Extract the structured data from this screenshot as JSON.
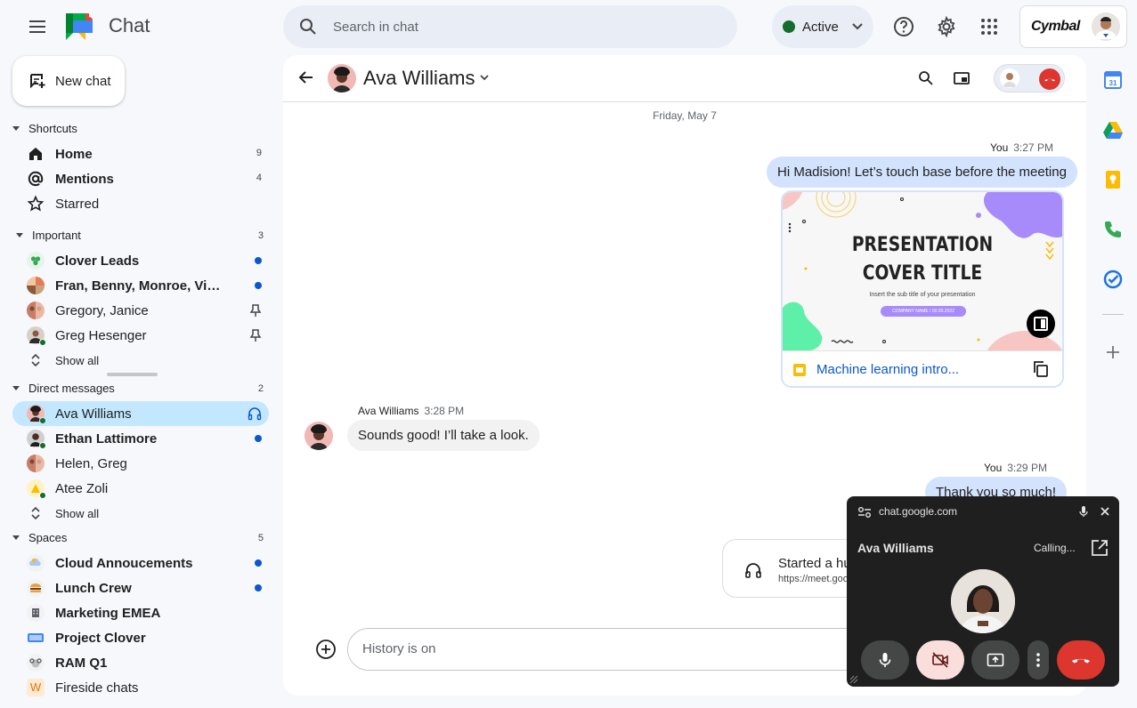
{
  "app": {
    "title": "Chat"
  },
  "search": {
    "placeholder": "Search in chat"
  },
  "status": {
    "label": "Active",
    "color": "#146c2e"
  },
  "account": {
    "brand": "Cymbal"
  },
  "sidebar": {
    "new_chat": "New chat",
    "shortcuts": {
      "title": "Shortcuts",
      "items": [
        {
          "label": "Home",
          "count": "9"
        },
        {
          "label": "Mentions",
          "count": "4"
        },
        {
          "label": "Starred",
          "count": ""
        }
      ]
    },
    "important": {
      "title": "Important",
      "count": "3",
      "items": [
        {
          "label": "Clover Leads"
        },
        {
          "label": "Fran, Benny, Monroe, Vin..."
        },
        {
          "label": "Gregory, Janice"
        },
        {
          "label": "Greg Hesenger"
        }
      ],
      "show_all": "Show all"
    },
    "direct_messages": {
      "title": "Direct messages",
      "count": "2",
      "items": [
        {
          "label": "Ava Williams"
        },
        {
          "label": "Ethan Lattimore"
        },
        {
          "label": "Helen, Greg"
        },
        {
          "label": "Atee Zoli"
        }
      ],
      "show_all": "Show all"
    },
    "spaces": {
      "title": "Spaces",
      "count": "5",
      "items": [
        {
          "label": "Cloud Annoucements"
        },
        {
          "label": "Lunch Crew"
        },
        {
          "label": "Marketing EMEA"
        },
        {
          "label": "Project Clover"
        },
        {
          "label": "RAM Q1"
        },
        {
          "label": "Fireside chats",
          "initial": "W"
        }
      ]
    }
  },
  "chat": {
    "contact_name": "Ava Williams",
    "date_separator": "Friday, May 7",
    "messages": [
      {
        "sender": "You",
        "time": "3:27 PM",
        "text": "Hi Madision! Let’s touch base before the meeting"
      },
      {
        "sender": "Ava Williams",
        "time": "3:28 PM",
        "text": "Sounds good! I’ll take a look."
      },
      {
        "sender": "You",
        "time": "3:29 PM",
        "text": "Thank you so much!"
      }
    ],
    "attachment": {
      "slide_title_1": "PRESENTATION",
      "slide_title_2": "COVER TITLE",
      "slide_subtitle": "Insert the sub title of your presentation",
      "slide_pill": "COMPANY NAME / 00.00.2022",
      "name": "Machine learning intro..."
    },
    "huddle": {
      "title": "Started a huddle",
      "url": "https://meet.google.com"
    },
    "compose_placeholder": "History is on"
  },
  "call_popup": {
    "url": "chat.google.com",
    "name": "Ava Williams",
    "status": "Calling..."
  },
  "colors": {
    "accent": "#0b57d0",
    "selected": "#c2e7ff",
    "outgoing": "#d3e3fd",
    "hangup": "#dc362e"
  }
}
